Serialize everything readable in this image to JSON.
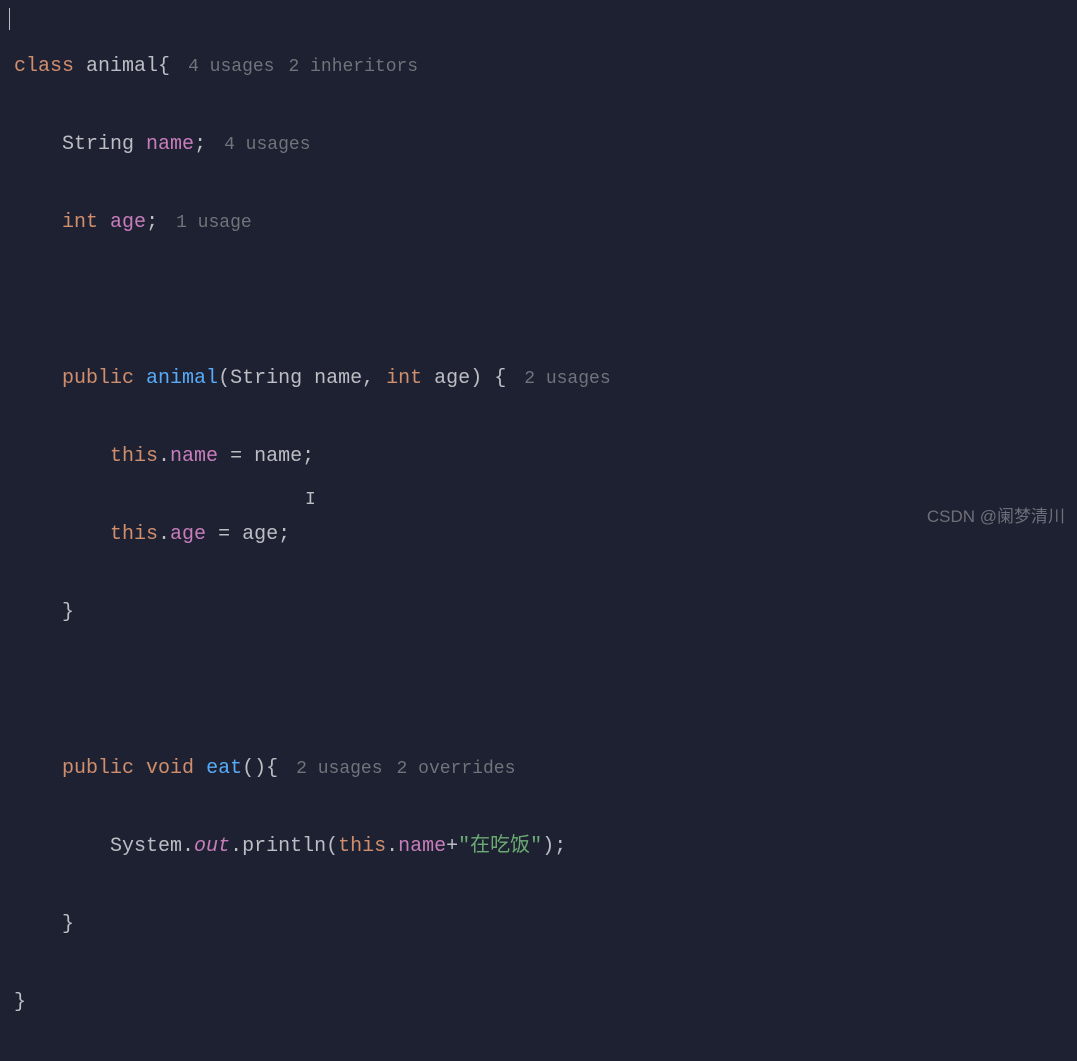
{
  "code": {
    "line1": {
      "keyword_class": "class",
      "class_name": "animal",
      "brace_open": "{"
    },
    "line1_hints": {
      "usages": "4 usages",
      "inheritors": "2 inheritors"
    },
    "line2": {
      "type": "String",
      "field": "name",
      "semicolon": ";"
    },
    "line2_hint": "4 usages",
    "line3": {
      "type": "int",
      "field": "age",
      "semicolon": ";"
    },
    "line3_hint": "1 usage",
    "line5": {
      "modifier": "public",
      "constructor": "animal",
      "paren_open": "(",
      "param1_type": "String",
      "param1_name": "name",
      "comma": ", ",
      "param2_type": "int",
      "param2_name": "age",
      "paren_close": ")",
      "brace_open": " {"
    },
    "line5_hint": "2 usages",
    "line6": {
      "this_kw": "this",
      "dot": ".",
      "field": "name",
      "assign": " = ",
      "var": "name",
      "semicolon": ";"
    },
    "line7": {
      "this_kw": "this",
      "dot": ".",
      "field": "age",
      "assign": " = ",
      "var": "age",
      "semicolon": ";"
    },
    "line8_brace": "}",
    "line10": {
      "modifier": "public",
      "return_type": "void",
      "method_name": "eat",
      "parens": "()",
      "brace_open": "{"
    },
    "line10_hints": {
      "usages": "2 usages",
      "overrides": "2 overrides"
    },
    "line11": {
      "class_ref": "System",
      "dot1": ".",
      "out_field": "out",
      "dot2": ".",
      "method": "println",
      "paren_open": "(",
      "this_kw": "this",
      "dot3": ".",
      "field": "name",
      "plus": "+",
      "string_literal": "\"在吃饭\"",
      "paren_close": ")",
      "semicolon": ";"
    },
    "line12_brace": "}",
    "line13_brace": "}"
  },
  "watermark": "CSDN @阑梦清川",
  "cursor": "I"
}
